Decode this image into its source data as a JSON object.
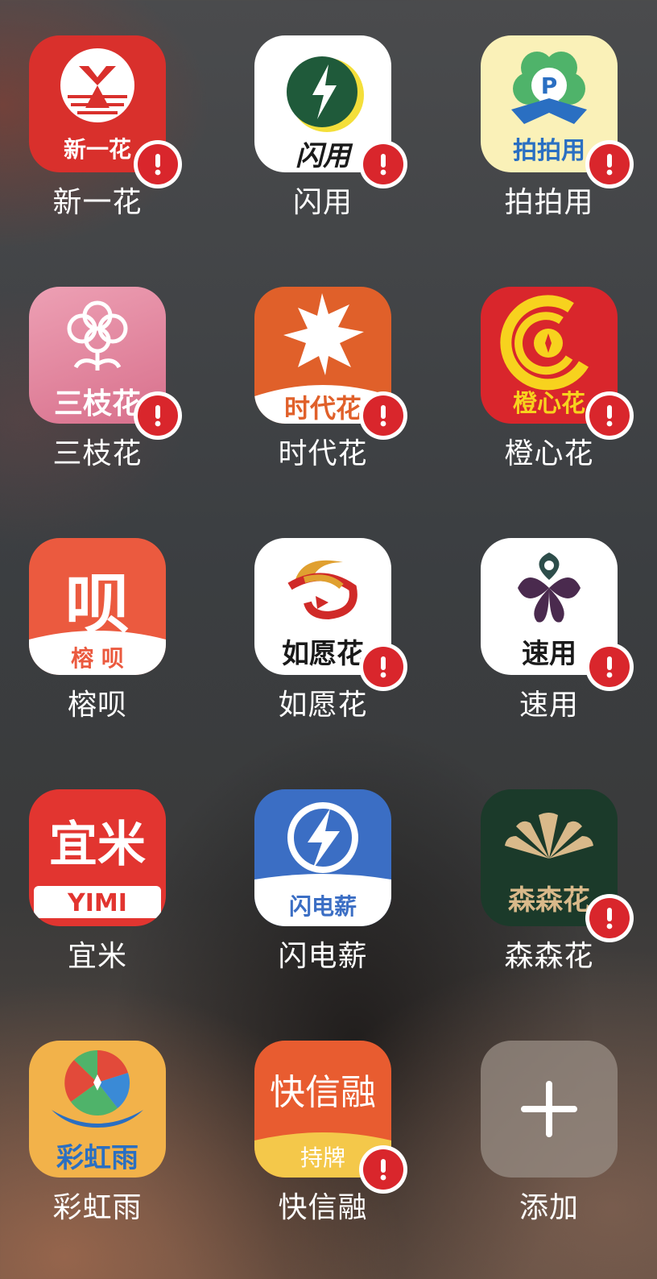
{
  "apps": [
    {
      "name": "新一花",
      "icon": "new-flower-app-icon",
      "icon_text": "新一花",
      "bg": "#d9302c",
      "warning": true
    },
    {
      "name": "闪用",
      "icon": "lightning-app-icon",
      "icon_text": "闪用",
      "bg": "#ffffff",
      "warning": true
    },
    {
      "name": "拍拍用",
      "icon": "clover-p-app-icon",
      "icon_text": "拍拍用",
      "bg": "#faf1b8",
      "warning": true
    },
    {
      "name": "三枝花",
      "icon": "flower-app-icon",
      "icon_text": "三枝花",
      "bg": "#e3849c",
      "warning": true
    },
    {
      "name": "时代花",
      "icon": "maple-leaf-app-icon",
      "icon_text": "时代花",
      "bg": "#e0602a",
      "warning": true
    },
    {
      "name": "橙心花",
      "icon": "coin-swirl-app-icon",
      "icon_text": "橙心花",
      "bg": "#d9262c",
      "warning": true
    },
    {
      "name": "榕呗",
      "icon": "rongbei-app-icon",
      "icon_text_big": "呗",
      "icon_text": "榕 呗",
      "bg": "#eb5a3f",
      "warning": false
    },
    {
      "name": "如愿花",
      "icon": "wish-swirl-app-icon",
      "icon_text": "如愿花",
      "bg": "#ffffff",
      "warning": true
    },
    {
      "name": "速用",
      "icon": "four-petal-app-icon",
      "icon_text": "速用",
      "bg": "#ffffff",
      "warning": true
    },
    {
      "name": "宜米",
      "icon": "yimi-app-icon",
      "icon_text_big": "宜米",
      "icon_text": "YIMI",
      "bg": "#e23530",
      "warning": false
    },
    {
      "name": "闪电薪",
      "icon": "lightning-bolt-app-icon",
      "icon_text": "闪电薪",
      "bg": "#3b6ec4",
      "warning": false
    },
    {
      "name": "森森花",
      "icon": "fan-leaf-app-icon",
      "icon_text": "森森花",
      "bg": "#1b3a2a",
      "warning": true
    },
    {
      "name": "彩虹雨",
      "icon": "rainbow-app-icon",
      "icon_text": "彩虹雨",
      "bg": "#f2b24a",
      "warning": false
    },
    {
      "name": "快信融",
      "icon": "kuaixinrong-app-icon",
      "icon_text_big": "快信融",
      "icon_text": "持牌",
      "bg": "#e85c30",
      "warning": true
    },
    {
      "name": "添加",
      "icon": "plus-icon",
      "icon_text": "",
      "bg": "rgba(140,130,125,0.75)",
      "warning": false
    }
  ],
  "colors": {
    "badge_red": "#d9262c",
    "label": "#ffffff"
  }
}
